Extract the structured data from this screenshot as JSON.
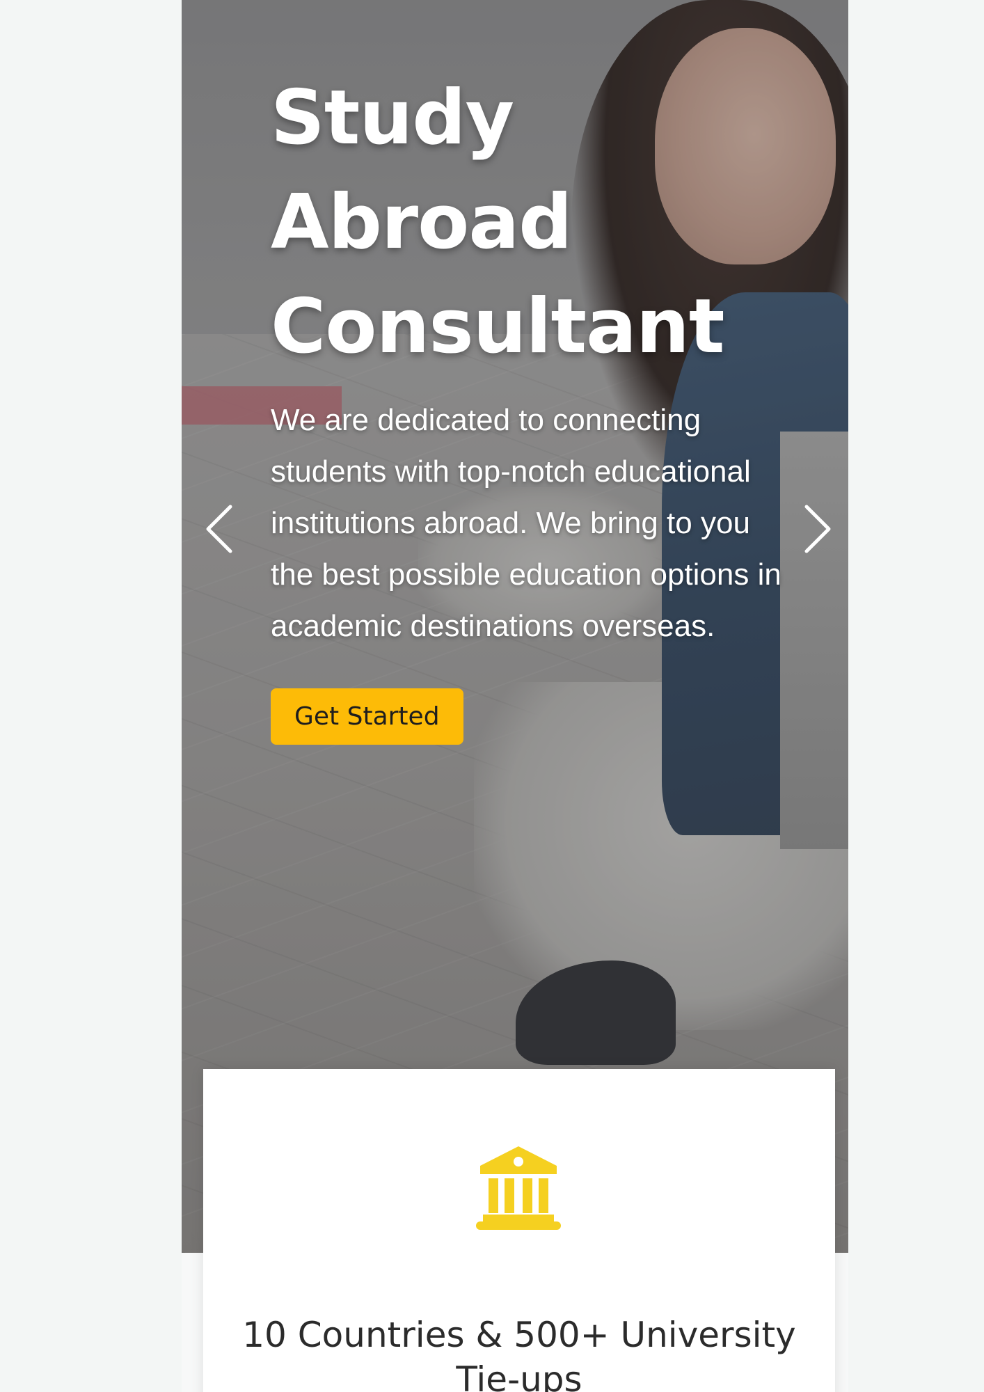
{
  "hero": {
    "title": "Study Abroad Consultant",
    "description": "We are dedicated to connecting students with top-notch educational institutions abroad. We bring to you the best possible education options in academic destinations overseas.",
    "cta_label": "Get Started",
    "prev_icon": "chevron-left-icon",
    "next_icon": "chevron-right-icon"
  },
  "feature_card": {
    "icon": "university-building-icon",
    "title": "10 Countries & 500+ University Tie-ups"
  },
  "colors": {
    "accent": "#fdbb07",
    "icon": "#f5d020",
    "card_background": "#ffffff",
    "heading_text": "#2b2b2b"
  }
}
